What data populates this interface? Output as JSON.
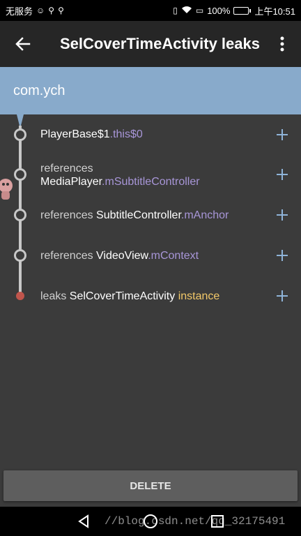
{
  "status_bar": {
    "carrier": "无服务",
    "battery_percent": "100%",
    "battery_level": 1.0,
    "time": "上午10:51"
  },
  "app_bar": {
    "title": "SelCoverTimeActivity leaks"
  },
  "header": {
    "package": "com.ych"
  },
  "trace": [
    {
      "prefix": "",
      "cls": "PlayerBase$1",
      "field": ".this$0",
      "suffix": ""
    },
    {
      "prefix": "references",
      "cls": "MediaPlayer",
      "field": ".mSubtitleController",
      "suffix": ""
    },
    {
      "prefix": "references ",
      "cls": "SubtitleController",
      "field": ".mAnchor",
      "suffix": ""
    },
    {
      "prefix": "references ",
      "cls": "VideoView",
      "field": ".mContext",
      "suffix": ""
    },
    {
      "prefix": "leaks ",
      "cls": "SelCoverTimeActivity",
      "field": "",
      "suffix": "instance"
    }
  ],
  "delete_label": "DELETE",
  "watermark": "//blog.csdn.net/qq_32175491",
  "colors": {
    "header_bg": "#88aacb",
    "field": "#a896d8",
    "instance": "#f3c969",
    "leak_node": "#c0554c",
    "plus": "#8fb4d9"
  }
}
